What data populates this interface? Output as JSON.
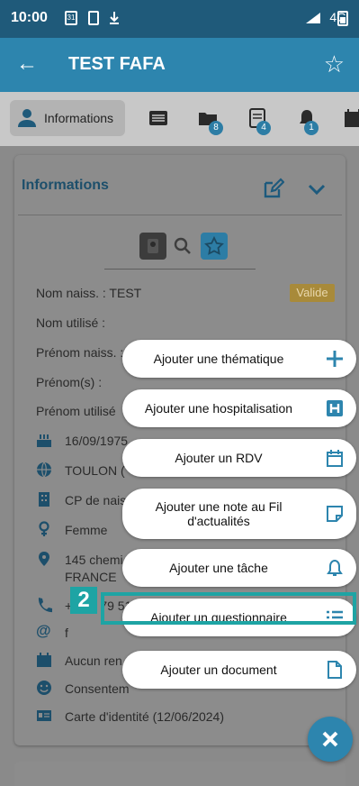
{
  "status_bar": {
    "time": "10:00",
    "left_icons": [
      "calendar-icon",
      "sim-icon",
      "download-icon"
    ],
    "right_text": "4G"
  },
  "app_bar": {
    "title": "TEST FAFA"
  },
  "tabs": {
    "active_label": "Informations",
    "badges": {
      "folder": "8",
      "checklist": "4",
      "bell": "1"
    }
  },
  "card": {
    "title": "Informations",
    "status": "Valide",
    "fields": {
      "nom_naiss": "Nom naiss. :  TEST",
      "nom_utilise": "Nom utilisé :",
      "prenom_naiss": "Prénom naiss. :",
      "prenoms": "Prénom(s) :",
      "prenom_utilise": "Prénom utilisé"
    },
    "rows": {
      "birth_date": "16/09/1975",
      "birth_place": "TOULON (",
      "cp_naiss": "CP de naiss",
      "sex": "Femme",
      "address_1": "145 chemi",
      "address_2": "FRANCE",
      "phone": "+33 4 79 51",
      "email": "f",
      "rdv": "Aucun ren",
      "consent": "Consentem",
      "id_card": "Carte d'identité (12/06/2024)"
    }
  },
  "fab_menu": {
    "items": [
      {
        "label": "Ajouter une thématique",
        "icon": "plus-icon"
      },
      {
        "label": "Ajouter une hospitalisation",
        "icon": "hospital-icon"
      },
      {
        "label": "Ajouter un RDV",
        "icon": "calendar-icon"
      },
      {
        "label": "Ajouter une note au Fil d'actualités",
        "icon": "note-icon"
      },
      {
        "label": "Ajouter une tâche",
        "icon": "bell-icon"
      },
      {
        "label": "Ajouter un questionnaire",
        "icon": "list-icon"
      },
      {
        "label": "Ajouter un document",
        "icon": "document-icon"
      }
    ]
  },
  "annotation": {
    "step": "2"
  },
  "colors": {
    "primary": "#2d85ae",
    "dark_primary": "#1f5a7a",
    "highlight": "#1ea4a4",
    "valide": "#a88a3a"
  }
}
